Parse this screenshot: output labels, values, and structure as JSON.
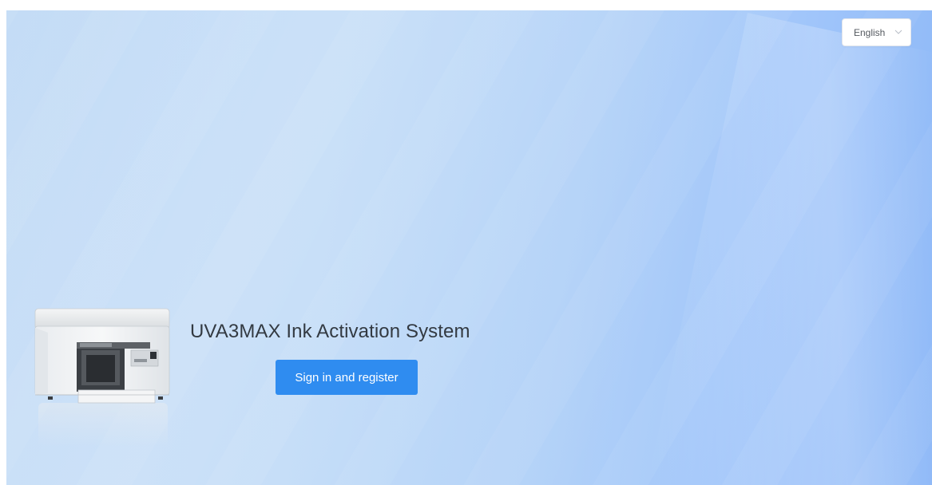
{
  "language_select": {
    "value": "English"
  },
  "hero": {
    "title": "UVA3MAX Ink Activation System",
    "signin_button_label": "Sign in and register"
  },
  "icons": {
    "language_chevron": "chevron-down-icon",
    "product_image": "printer-image"
  },
  "colors": {
    "primary_button": "#2f8cf0",
    "background_light": "#c4dcf6",
    "background_dark": "#8ab6f7",
    "title_text": "#333a42"
  }
}
